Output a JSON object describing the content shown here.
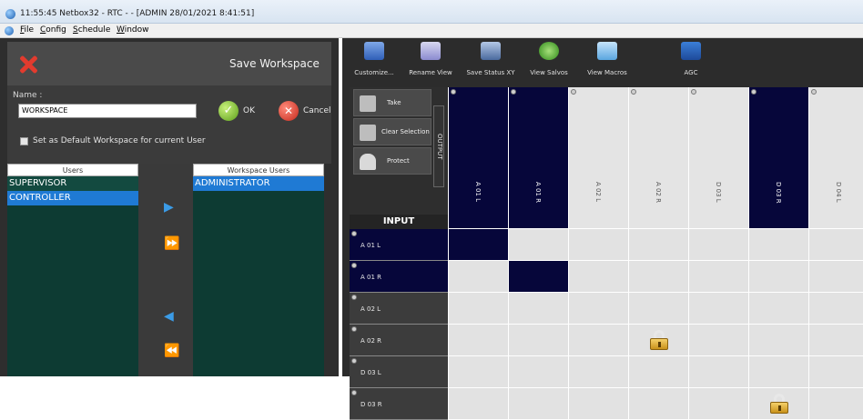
{
  "window": {
    "title": "11:55:45  Netbox32  -  RTC  -  - [ADMIN 28/01/2021 8:41:51]"
  },
  "menu": [
    "File",
    "Config",
    "Schedule",
    "Window"
  ],
  "save_workspace": {
    "title": "Save Workspace",
    "name_label": "Name :",
    "name_value": "WORKSPACE",
    "ok_label": "OK",
    "cancel_label": "Cancel",
    "default_checkbox_label": "Set as Default Workspace for current User",
    "default_checked": false,
    "users": {
      "header": "Users",
      "items": [
        "SUPERVISOR",
        "CONTROLLER"
      ],
      "selected": "CONTROLLER"
    },
    "workspace_users": {
      "header": "Workspace Users",
      "items": [
        "ADMINISTRATOR"
      ],
      "selected": "ADMINISTRATOR"
    },
    "arrows": [
      "add-selected",
      "add-all",
      "remove-selected",
      "remove-all"
    ]
  },
  "toolbar": [
    {
      "label": "Customize...",
      "icon": "customize-icon"
    },
    {
      "label": "Rename View",
      "icon": "rename-icon"
    },
    {
      "label": "Save Status XY",
      "icon": "save-status-icon"
    },
    {
      "label": "View Salvos",
      "icon": "salvos-icon"
    },
    {
      "label": "View Macros",
      "icon": "macros-icon"
    },
    {
      "label": "AGC",
      "icon": "agc-icon"
    }
  ],
  "matrix": {
    "controls": [
      "Take",
      "Clear Selection",
      "Protect"
    ],
    "output_label": "OUTPUT",
    "input_label": "INPUT",
    "columns": [
      "A 01 L",
      "A 01 R",
      "A 02 L",
      "A 02 R",
      "D 03 L",
      "D 03 R",
      "D 04 L"
    ],
    "rows": [
      "A 01 L",
      "A 01 R",
      "A 02 L",
      "A 02 R",
      "D 03 L",
      "D 03 R"
    ],
    "active_columns": [
      0,
      1,
      5
    ],
    "crosspoints": [
      {
        "row": 0,
        "col": 0,
        "state": "routed"
      },
      {
        "row": 1,
        "col": 1,
        "state": "routed"
      },
      {
        "row": 3,
        "col": 3,
        "state": "locked"
      },
      {
        "row": 5,
        "col": 5,
        "state": "locked"
      }
    ]
  }
}
